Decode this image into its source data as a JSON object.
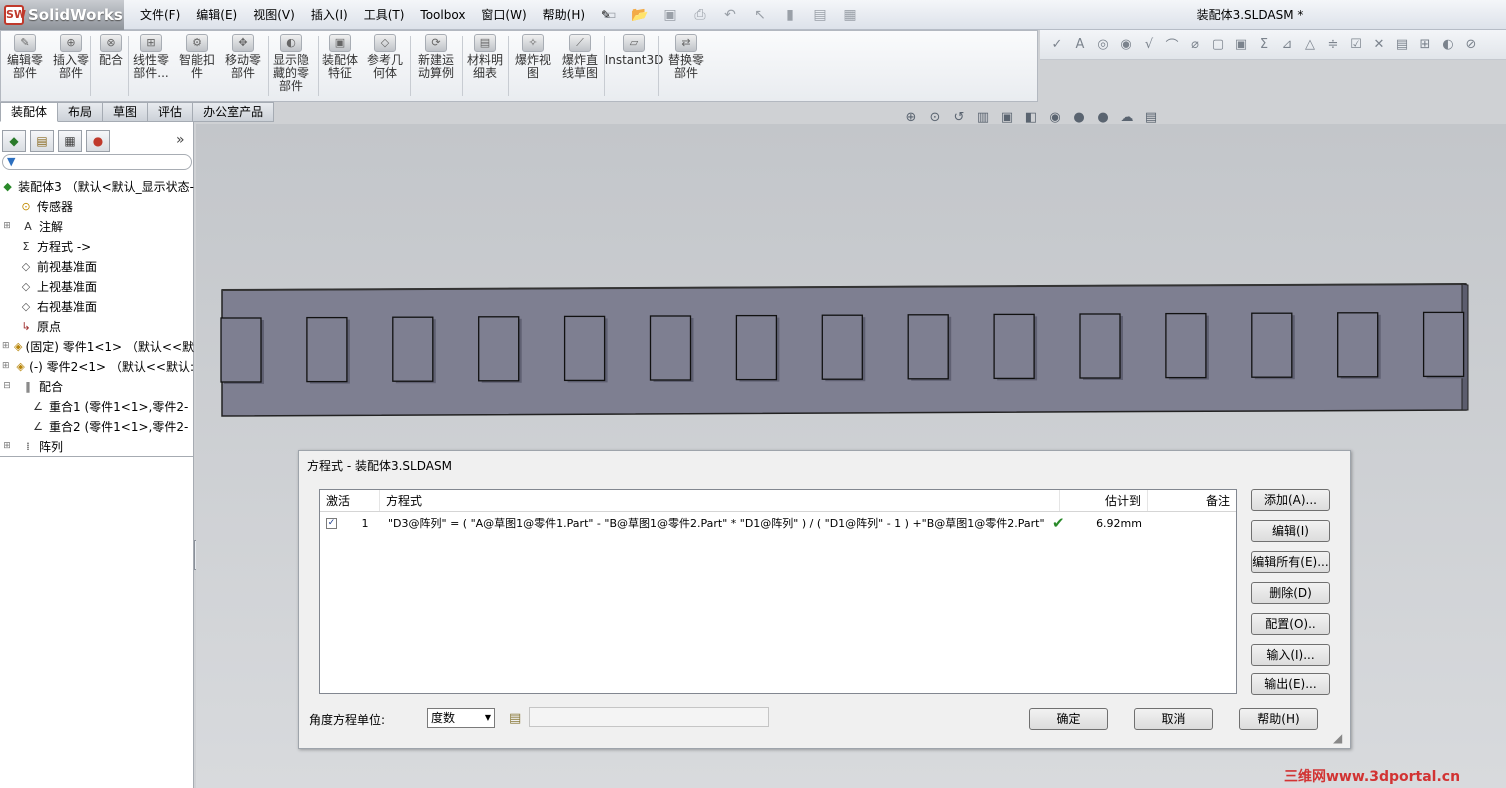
{
  "app": {
    "name": "SolidWorks",
    "doc_title": "装配体3.SLDASM *"
  },
  "menu": [
    "文件(F)",
    "编辑(E)",
    "视图(V)",
    "插入(I)",
    "工具(T)",
    "Toolbox",
    "窗口(W)",
    "帮助(H)"
  ],
  "command_manager": {
    "buttons": [
      {
        "label": "编辑零部件"
      },
      {
        "label": "插入零部件"
      },
      {
        "label": "配合"
      },
      {
        "label": "线性零部件..."
      },
      {
        "label": "智能扣件"
      },
      {
        "label": "移动零部件"
      },
      {
        "label": "显示隐藏的零部件"
      },
      {
        "label": "装配体特征"
      },
      {
        "label": "参考几何体"
      },
      {
        "label": "新建运动算例"
      },
      {
        "label": "材料明细表"
      },
      {
        "label": "爆炸视图"
      },
      {
        "label": "爆炸直线草图"
      },
      {
        "label": "Instant3D"
      },
      {
        "label": "替换零部件"
      }
    ],
    "tabs": [
      "装配体",
      "布局",
      "草图",
      "评估",
      "办公室产品"
    ]
  },
  "tree": {
    "root": "装配体3 （默认<默认_显示状态-",
    "items": [
      {
        "label": "传感器"
      },
      {
        "label": "注解"
      },
      {
        "label": "方程式 ->"
      },
      {
        "label": "前视基准面"
      },
      {
        "label": "上视基准面"
      },
      {
        "label": "右视基准面"
      },
      {
        "label": "原点"
      },
      {
        "label": "(固定) 零件1<1> （默认<<默"
      },
      {
        "label": "(-) 零件2<1> （默认<<默认:"
      },
      {
        "label": "配合"
      },
      {
        "label": "重合1 (零件1<1>,零件2-"
      },
      {
        "label": "重合2 (零件1<1>,零件2-"
      },
      {
        "label": "阵列"
      }
    ]
  },
  "model": {
    "tab_count": 15,
    "plate_color": "#7e7f91"
  },
  "dialog": {
    "title": "方程式 - 装配体3.SLDASM",
    "columns": {
      "active": "激活",
      "equation": "方程式",
      "estimate": "估计到",
      "note": "备注"
    },
    "rows": [
      {
        "index": "1",
        "equation": "\"D3@阵列\" = ( \"A@草图1@零件1.Part\" - \"B@草图1@零件2.Part\" * \"D1@阵列\" ) / ( \"D1@阵列\" - 1 ) +\"B@草图1@零件2.Part\"",
        "estimate": "6.92mm"
      }
    ],
    "buttons": {
      "add": "添加(A)...",
      "edit": "编辑(I)",
      "edit_all": "编辑所有(E)...",
      "delete": "删除(D)",
      "config": "配置(O)..",
      "import": "输入(I)...",
      "export": "输出(E)...",
      "ok": "确定",
      "cancel": "取消",
      "help": "帮助(H)"
    },
    "angle_unit_label": "角度方程单位:",
    "angle_unit_value": "度数"
  },
  "watermark": "三维网www.3dportal.cn"
}
